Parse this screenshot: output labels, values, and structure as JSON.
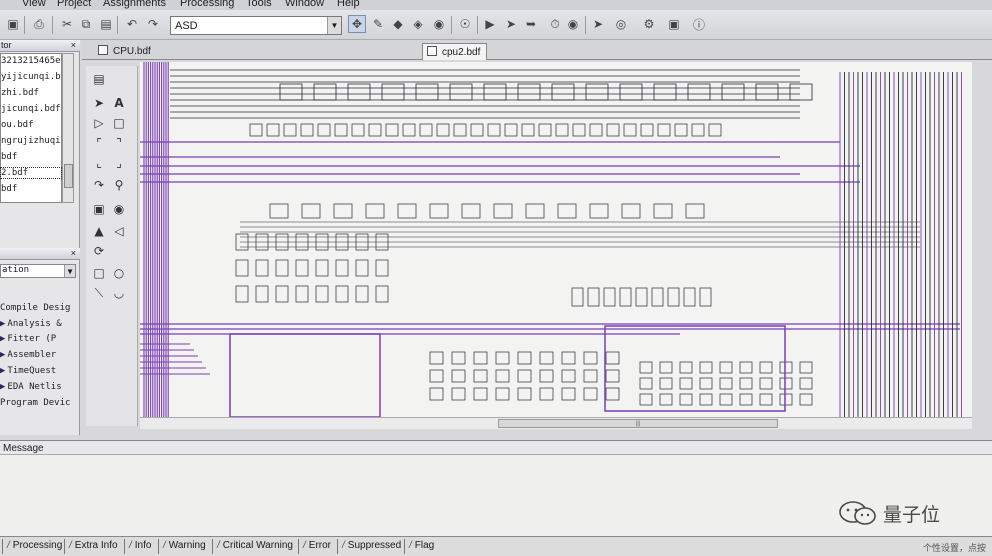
{
  "menubar": {
    "items": [
      "View",
      "Project",
      "Assignments",
      "Processing",
      "Tools",
      "Window",
      "Help"
    ]
  },
  "toolbar": {
    "project_combo_value": "ASD"
  },
  "project_navigator": {
    "title": "tor",
    "files": [
      "3213215465e",
      "yijicunqi.bd",
      "zhi.bdf",
      "jicunqi.bdf",
      "ou.bdf",
      "ngrujizhuqi.",
      "bdf",
      "2.bdf",
      "bdf"
    ],
    "selected_index": 7
  },
  "tasks": {
    "flow_combo": "ation",
    "items": [
      "Compile Desig",
      "Analysis &",
      "Fitter (P",
      "Assembler",
      "TimeQuest",
      "EDA Netlis",
      "Program Devic"
    ]
  },
  "document_tabs": [
    {
      "label": "CPU.bdf",
      "active": false
    },
    {
      "label": "cpu2.bdf",
      "active": true
    }
  ],
  "messages": {
    "title": "Message",
    "tabs": [
      "Processing",
      "Extra Info",
      "Info",
      "Warning",
      "Critical Warning",
      "Error",
      "Suppressed",
      "Flag"
    ],
    "status": "个性设置，点按"
  },
  "watermark": {
    "text": "量子位"
  },
  "colors": {
    "wire_purple": "#7a3fb6",
    "wire_dark": "#2a2a38",
    "canvas_bg": "#f3f3f1"
  }
}
